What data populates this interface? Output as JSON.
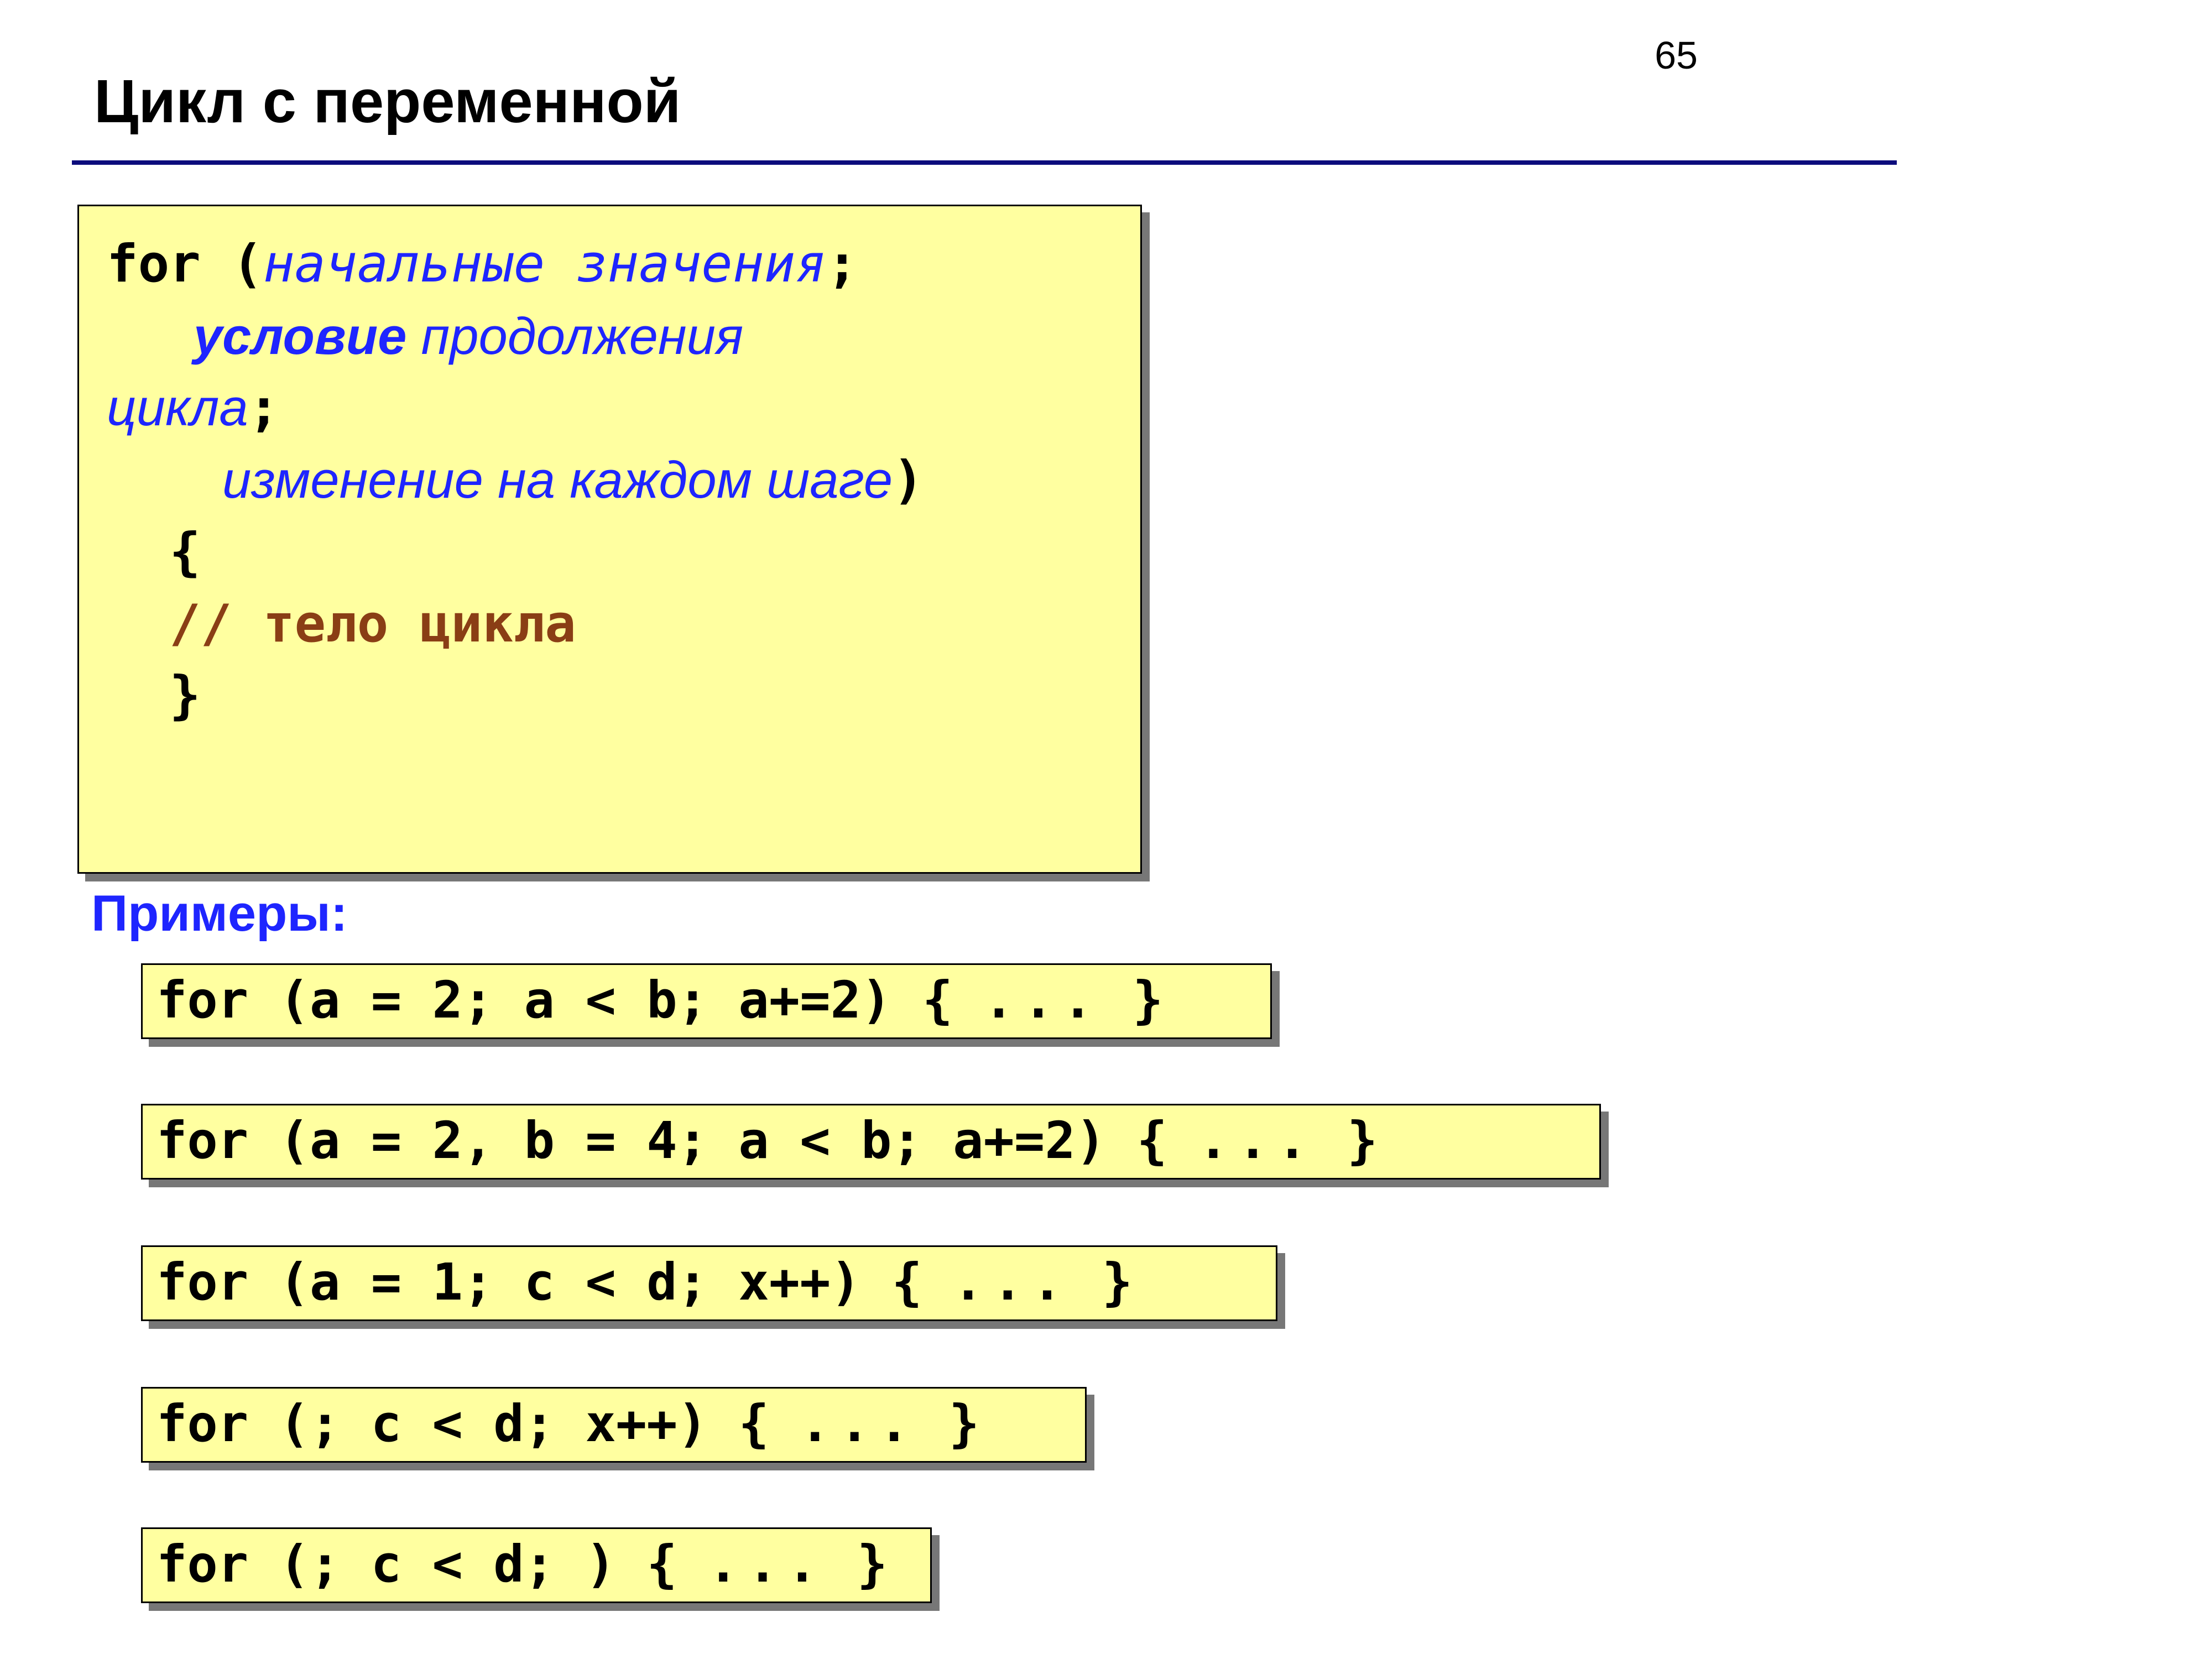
{
  "page_number": "65",
  "title": "Цикл с переменной",
  "main": {
    "for_kw": "for (",
    "init": "начальные значения",
    "semi1": ";",
    "cond_kw": "условие",
    "cond_rest": " продолжения цикла",
    "semi2": ";",
    "step": "изменение на каждом шаге",
    "close_paren": ")",
    "open_brace": "{",
    "comment": "// тело цикла",
    "close_brace": "}"
  },
  "examples_label": "Примеры:",
  "examples": {
    "ex1_a": "for (a",
    "ex1_b": "=",
    "ex1_c": "2; a",
    "ex1_d": "<",
    "ex1_e": "b; a+=2) { ",
    "ex1_f": "...",
    "ex1_g": " }",
    "ex2_a": "for (a",
    "ex2_b": "=",
    "ex2_c": "2, b",
    "ex2_d": "=",
    "ex2_e": "4; a",
    "ex2_f": "<",
    "ex2_g": "b; a+=2) { ",
    "ex2_h": "...",
    "ex2_i": " }",
    "ex3_a": "for (a",
    "ex3_b": "=",
    "ex3_c": "1; c",
    "ex3_d": "<",
    "ex3_e": "d; x++) { ",
    "ex3_f": "...",
    "ex3_g": " }",
    "ex4_a": "for (; c",
    "ex4_b": "<",
    "ex4_c": "d; x++) { ",
    "ex4_d": "...",
    "ex4_e": " }",
    "ex5_a": "for (; c",
    "ex5_b": "<",
    "ex5_c": "d; ) { ",
    "ex5_d": "...",
    "ex5_e": " }"
  }
}
